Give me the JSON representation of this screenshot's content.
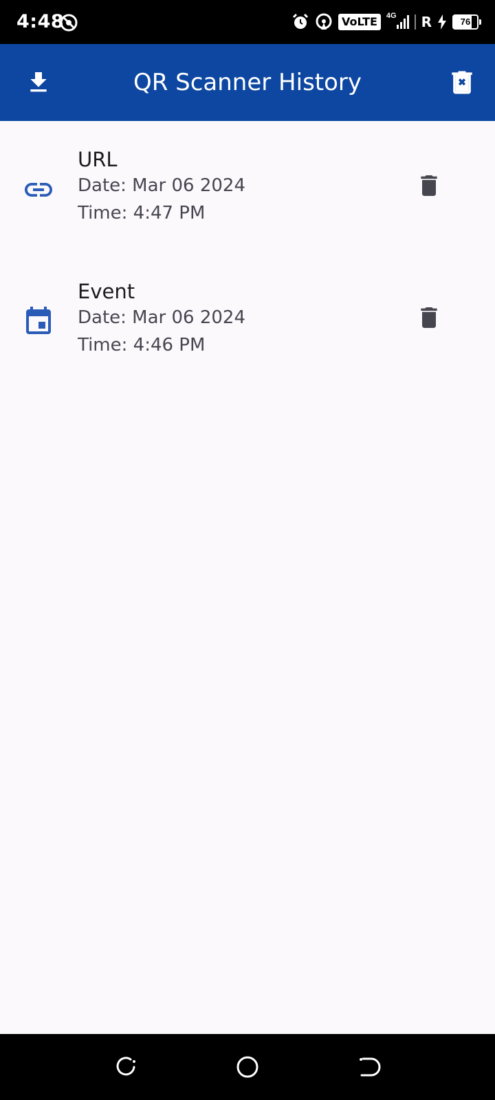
{
  "status_bar": {
    "time": "4:48",
    "volte": "VoLTE",
    "network_type": "4G",
    "roaming": "R",
    "battery_percent": "76",
    "icons": [
      "do-not-disturb-icon",
      "alarm-icon",
      "hotspot-icon",
      "signal-icon",
      "charging-icon",
      "battery-icon"
    ]
  },
  "app_bar": {
    "title": "QR Scanner History",
    "left_action_icon": "download-icon",
    "right_action_icon": "delete-all-icon",
    "color": "#0d47a1"
  },
  "history": {
    "items": [
      {
        "type": "URL",
        "icon": "link-icon",
        "date": "Date: Mar 06 2024",
        "time": "Time: 4:47 PM"
      },
      {
        "type": "Event",
        "icon": "calendar-icon",
        "date": "Date: Mar 06 2024",
        "time": "Time: 4:46 PM"
      }
    ],
    "item_icon_color": "#2a5bb7",
    "delete_icon_color": "#46464f"
  },
  "nav_bar": {
    "icons": [
      "recents-icon",
      "home-icon",
      "back-icon"
    ]
  }
}
